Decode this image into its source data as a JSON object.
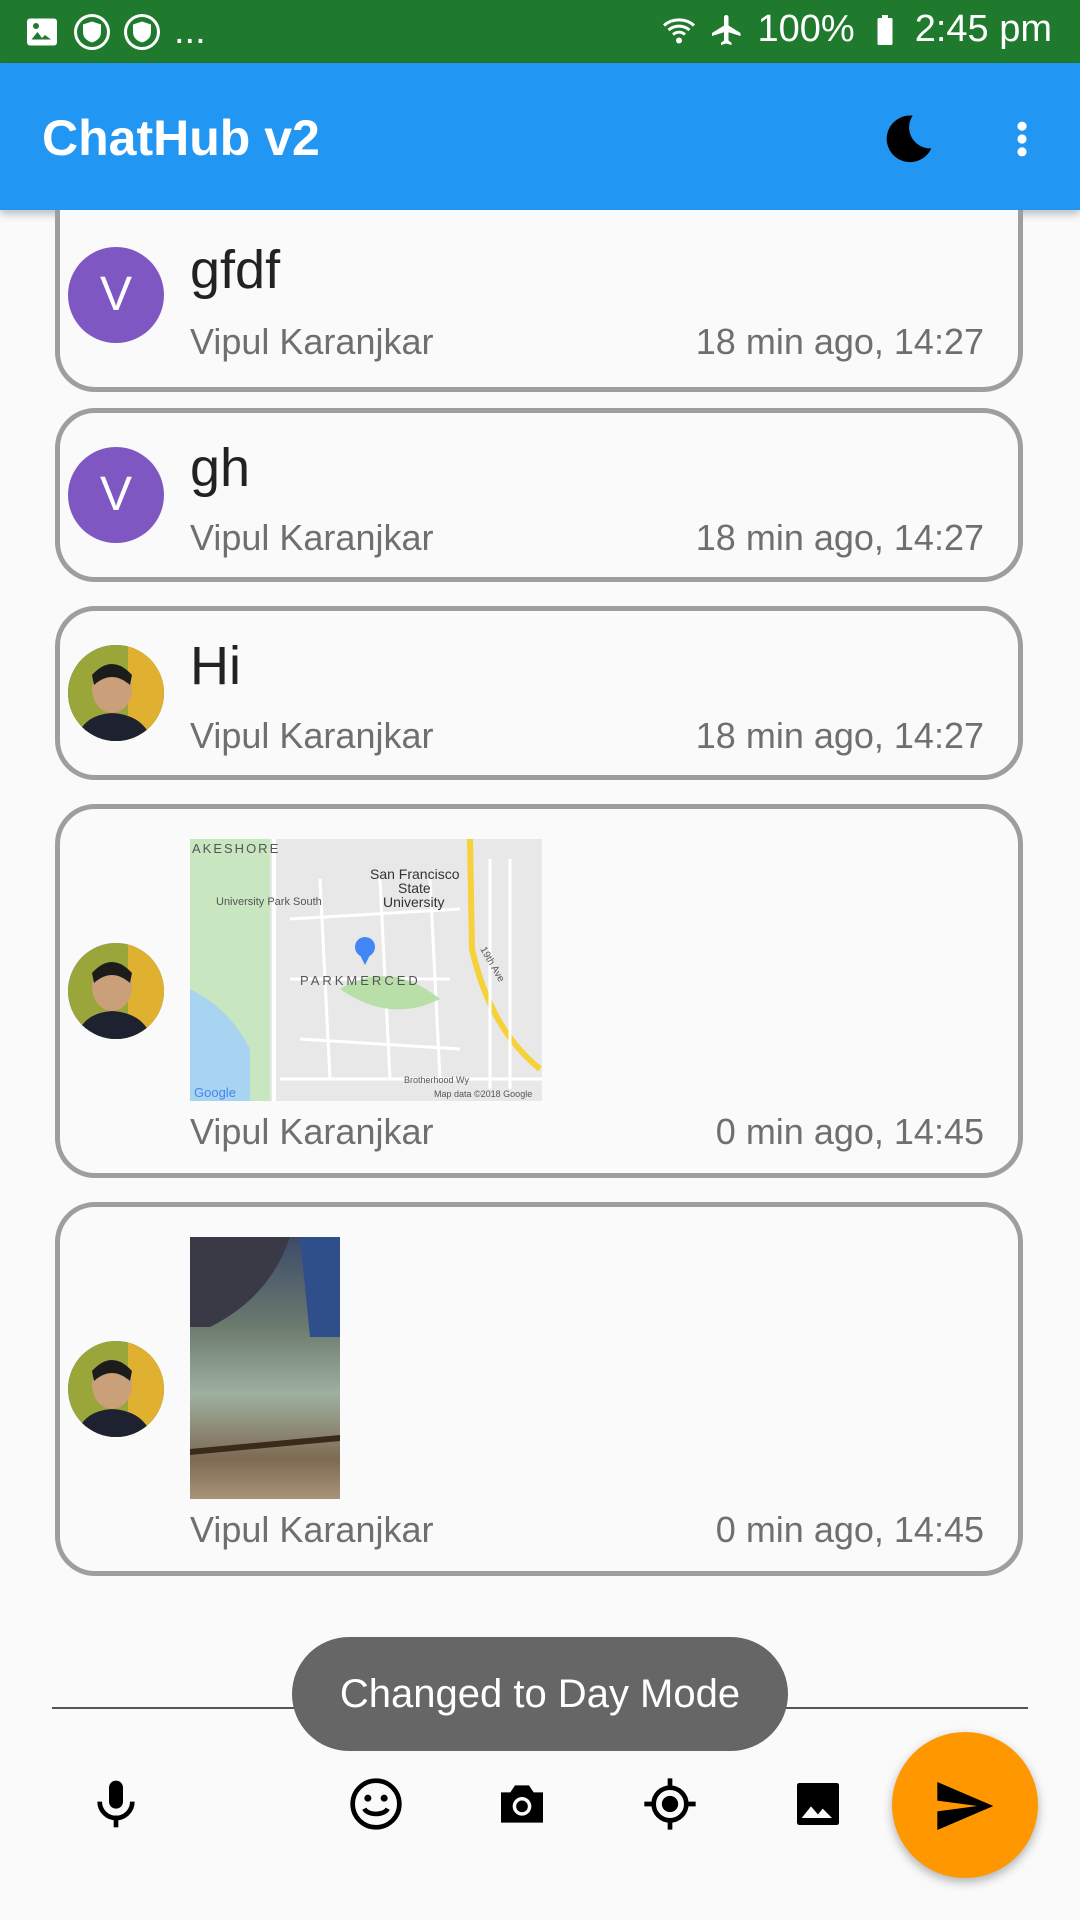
{
  "status_bar": {
    "left_more": "...",
    "battery": "100%",
    "time": "2:45 pm"
  },
  "app_bar": {
    "title": "ChatHub v2",
    "night_mode_icon": "moon-icon",
    "menu_icon": "more-vert-icon"
  },
  "messages": [
    {
      "avatar_letter": "V",
      "text": "gfdf",
      "sender": "Vipul Karanjkar",
      "time": "18 min ago, 14:27"
    },
    {
      "avatar_letter": "V",
      "text": "gh",
      "sender": "Vipul Karanjkar",
      "time": "18 min ago, 14:27"
    },
    {
      "avatar_letter": "",
      "text": "Hi",
      "sender": "Vipul Karanjkar",
      "time": "18 min ago, 14:27"
    },
    {
      "avatar_letter": "",
      "text": "",
      "sender": "Vipul Karanjkar",
      "time": "0 min ago, 14:45",
      "map": {
        "l1": "AKESHORE",
        "l2": "San Francisco",
        "l3": "State",
        "l4": "University",
        "l5": "University Park South",
        "l6": "PARKMERCED",
        "l7": "19th Ave",
        "l8": "Google",
        "l9": "Map data ©2018 Google",
        "l10": "Brotherhood Wy"
      }
    },
    {
      "avatar_letter": "",
      "text": "",
      "sender": "Vipul Karanjkar",
      "time": "0 min ago, 14:45"
    }
  ],
  "toast": "Changed to Day Mode",
  "toolbar": {
    "mic": "mic-icon",
    "emoji": "emoji-icon",
    "camera": "camera-icon",
    "location": "location-icon",
    "image": "image-icon",
    "send": "send-icon"
  },
  "colors": {
    "status_bar": "#1f7a2e",
    "app_bar": "#2196f3",
    "avatar": "#7e57c2",
    "send": "#ff9800"
  }
}
